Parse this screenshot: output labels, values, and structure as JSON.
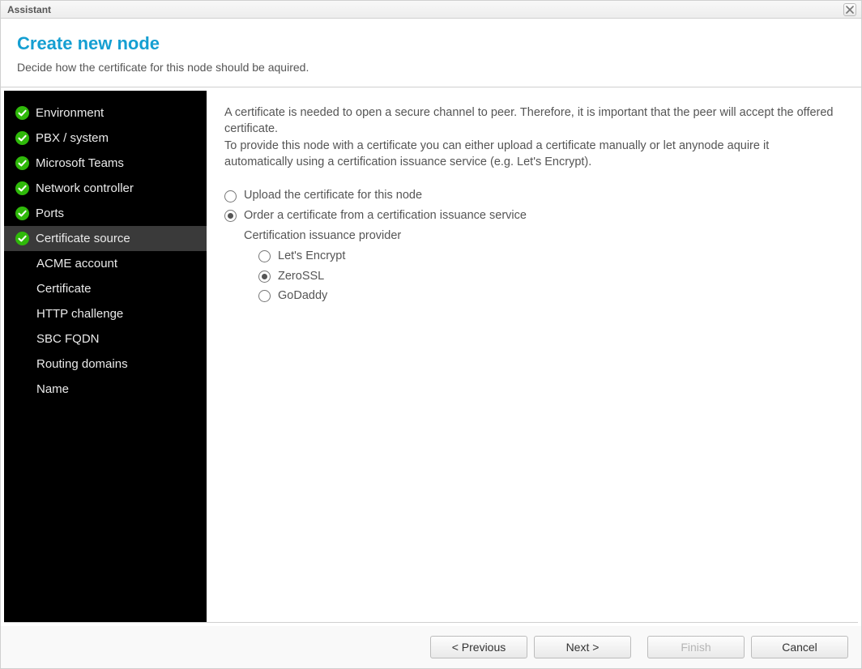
{
  "window": {
    "title": "Assistant"
  },
  "header": {
    "title": "Create new node",
    "subtitle": "Decide how the certificate for this node should be aquired."
  },
  "sidebar": {
    "steps": [
      {
        "label": "Environment",
        "completed": true
      },
      {
        "label": "PBX / system",
        "completed": true
      },
      {
        "label": "Microsoft Teams",
        "completed": true
      },
      {
        "label": "Network controller",
        "completed": true
      },
      {
        "label": "Ports",
        "completed": true
      },
      {
        "label": "Certificate source",
        "completed": true,
        "selected": true
      },
      {
        "label": "ACME account",
        "sub": true
      },
      {
        "label": "Certificate",
        "sub": true
      },
      {
        "label": "HTTP challenge",
        "sub": true
      },
      {
        "label": "SBC FQDN",
        "sub": true
      },
      {
        "label": "Routing domains",
        "sub": true
      },
      {
        "label": "Name",
        "sub": true
      }
    ]
  },
  "content": {
    "intro_line1": "A certificate is needed to open a secure channel to peer. Therefore, it is important that the peer will accept the offered certificate.",
    "intro_line2": "To provide this node with a certificate you can either upload a certificate manually or let anynode aquire it automatically using a certification issuance service (e.g. Let's Encrypt).",
    "source_options": [
      {
        "label": "Upload the certificate for this node",
        "selected": false
      },
      {
        "label": "Order a certificate from a certification issuance service",
        "selected": true
      }
    ],
    "provider_section_label": "Certification issuance provider",
    "provider_options": [
      {
        "label": "Let's Encrypt",
        "selected": false
      },
      {
        "label": "ZeroSSL",
        "selected": true
      },
      {
        "label": "GoDaddy",
        "selected": false
      }
    ]
  },
  "footer": {
    "previous": "< Previous",
    "next": "Next >",
    "finish": "Finish",
    "cancel": "Cancel",
    "finish_enabled": false
  }
}
